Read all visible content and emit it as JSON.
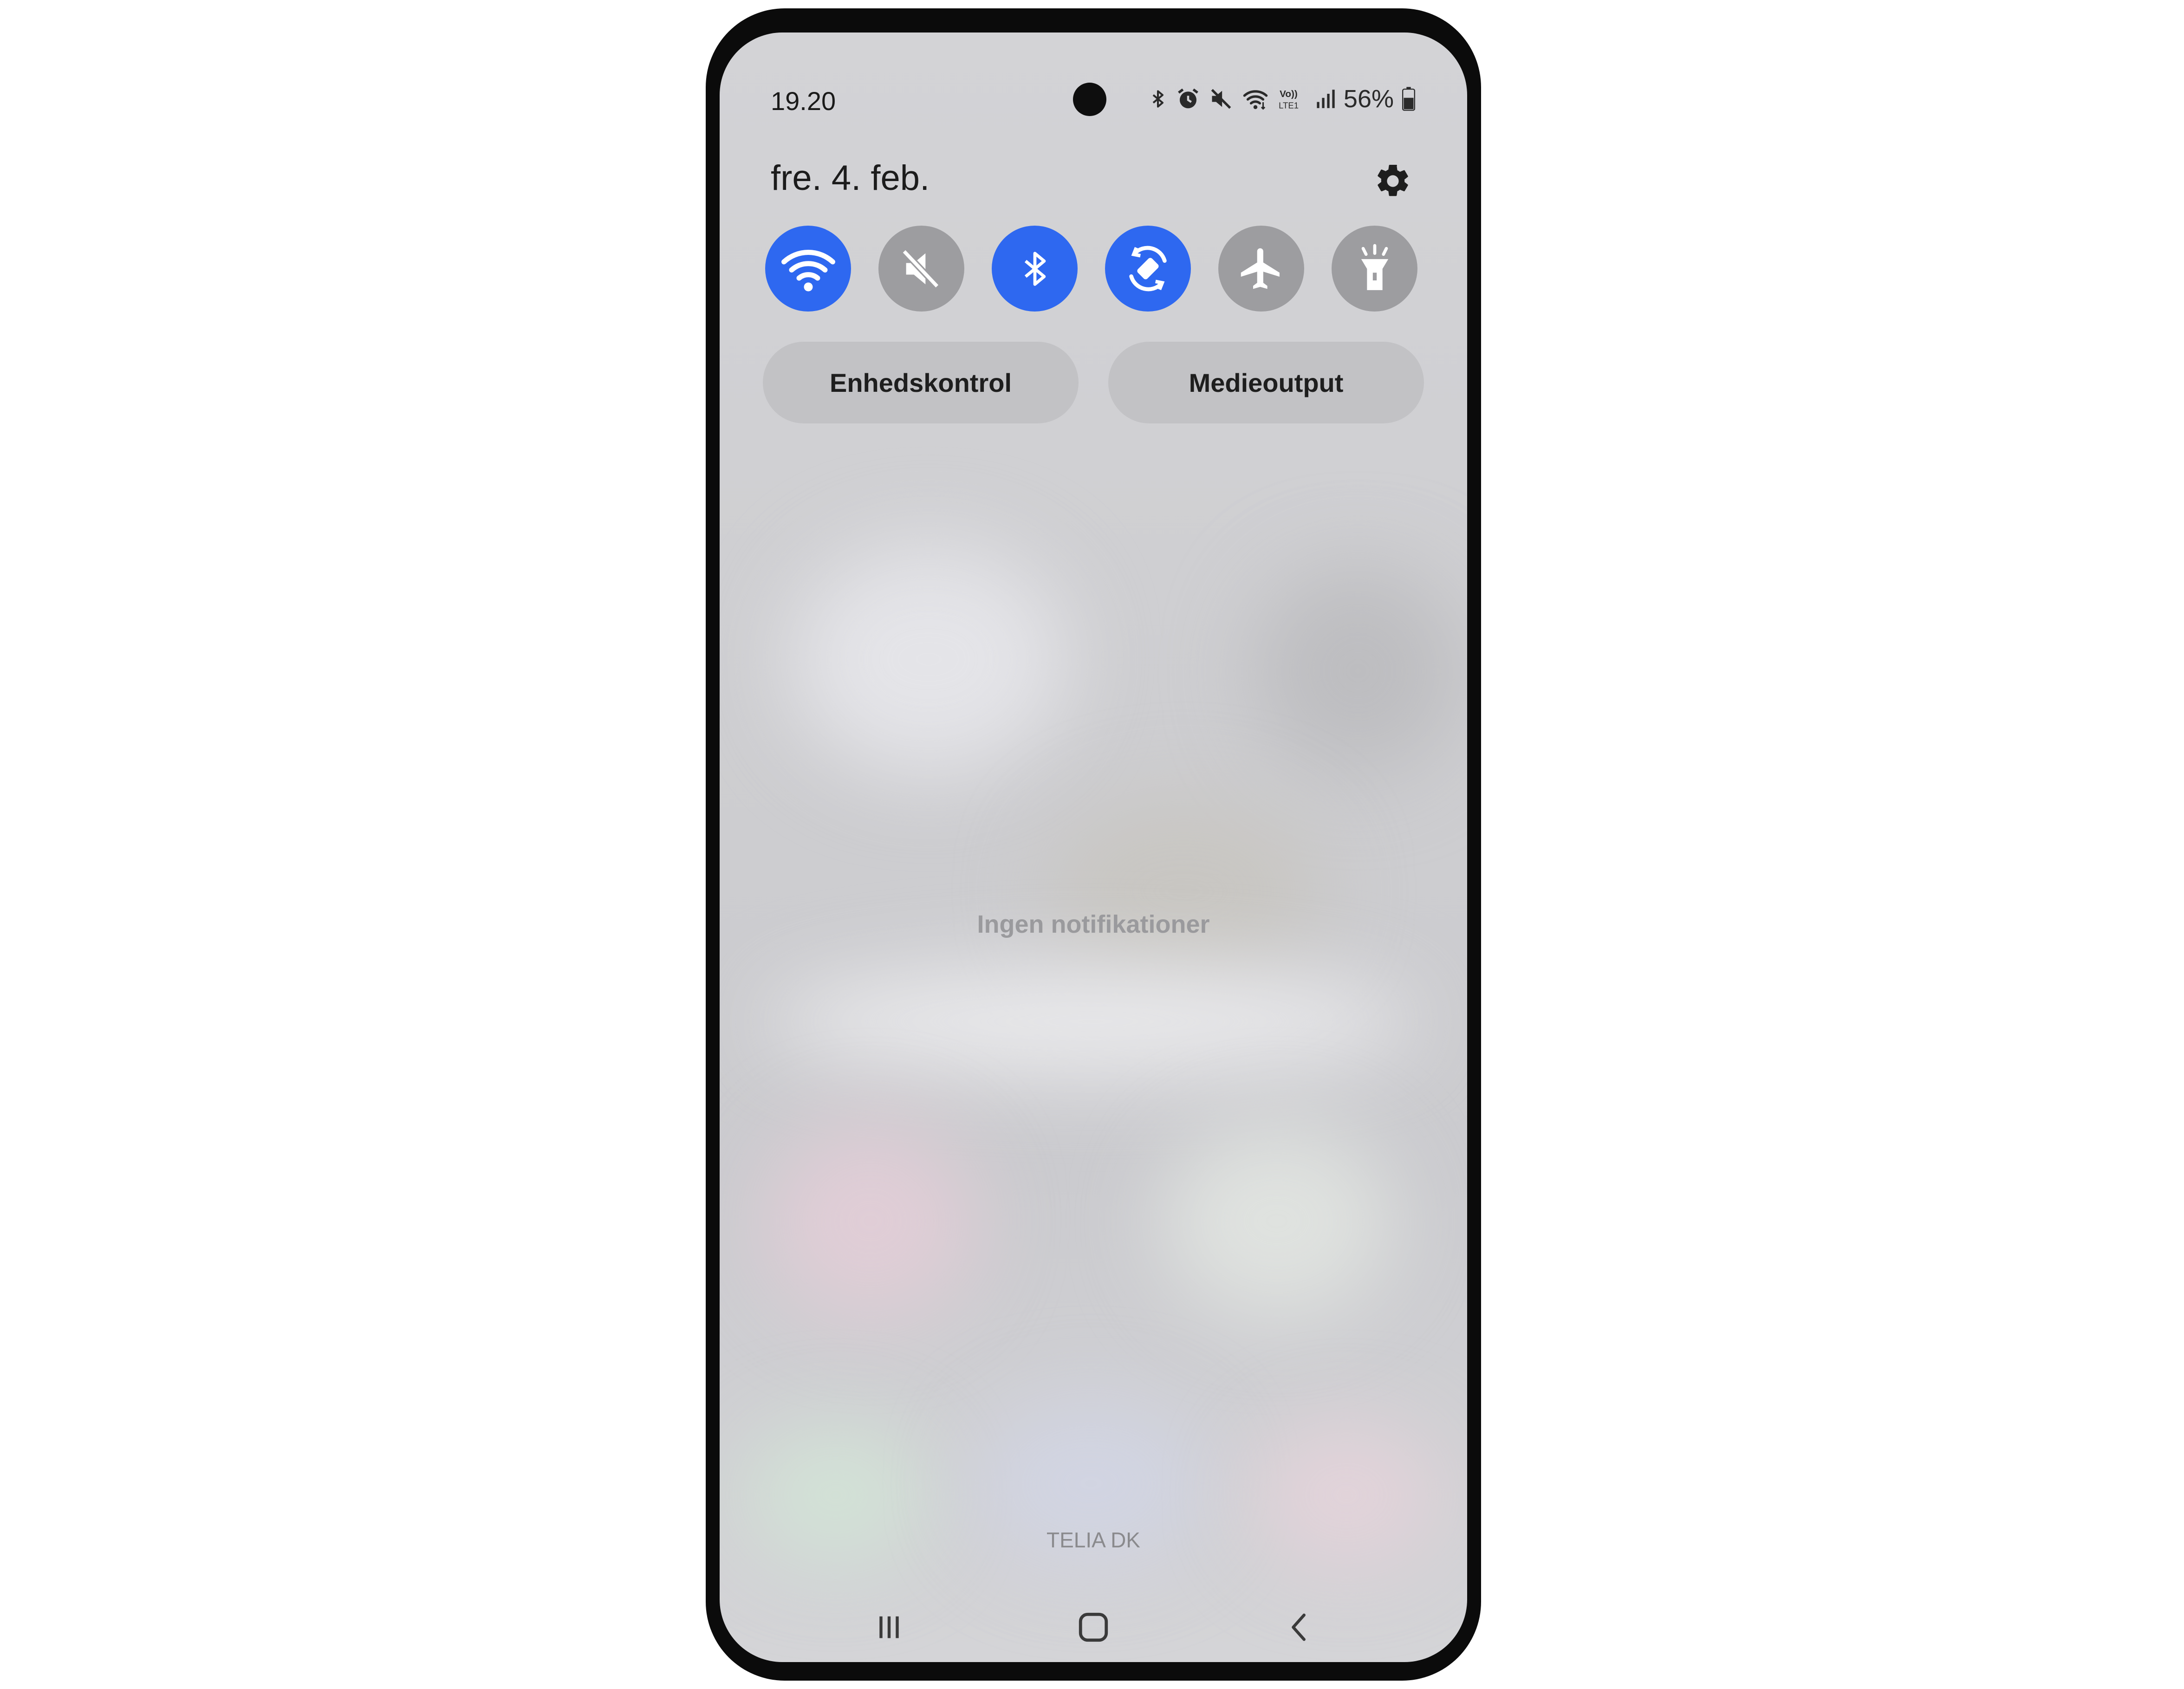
{
  "status_bar": {
    "time": "19.20",
    "battery": "56%",
    "icons": [
      "bluetooth-icon",
      "alarm-icon",
      "mute-icon",
      "wifi-icon",
      "volte-lte-icon",
      "signal-icon",
      "battery-icon"
    ],
    "volte_label": "Vo)) LTE1"
  },
  "header": {
    "date": "fre. 4. feb.",
    "settings_icon": "gear-icon"
  },
  "quick_settings": [
    {
      "name": "wifi",
      "icon": "wifi-icon",
      "active": true
    },
    {
      "name": "sound",
      "icon": "mute-icon",
      "active": false
    },
    {
      "name": "bluetooth",
      "icon": "bluetooth-icon",
      "active": true
    },
    {
      "name": "auto-rotate",
      "icon": "rotate-icon",
      "active": true
    },
    {
      "name": "airplane",
      "icon": "airplane-icon",
      "active": false
    },
    {
      "name": "flashlight",
      "icon": "flashlight-icon",
      "active": false
    }
  ],
  "buttons": {
    "device_control": "Enhedskontrol",
    "media_output": "Medieoutput"
  },
  "notifications": {
    "empty_text": "Ingen notifikationer"
  },
  "carrier": "TELIA DK",
  "navigation": {
    "recents": "recents-icon",
    "home": "home-icon",
    "back": "back-icon"
  },
  "colors": {
    "accent": "#2e68f0",
    "tile_off": "#9d9da0",
    "pill": "#c2c2c5"
  }
}
